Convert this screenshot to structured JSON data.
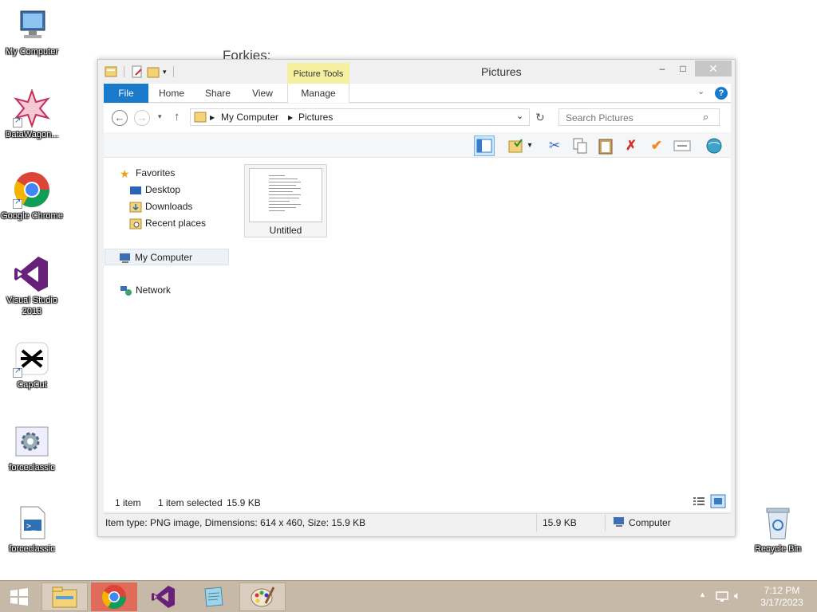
{
  "desktop": {
    "background_text": "Forkies:",
    "icons": [
      {
        "label": "My Computer"
      },
      {
        "label": "DataWagon..."
      },
      {
        "label": "Google Chrome"
      },
      {
        "label": "Visual Studio 2013"
      },
      {
        "label": "CapCut"
      },
      {
        "label": "forceclassic"
      },
      {
        "label": "forceclassic"
      },
      {
        "label": "Recycle Bin"
      }
    ]
  },
  "window": {
    "title": "Pictures",
    "context_tab": "Picture Tools",
    "ribbon_tabs": [
      "File",
      "Home",
      "Share",
      "View",
      "Manage"
    ],
    "address": {
      "segments": [
        "My Computer",
        "Pictures"
      ]
    },
    "search": {
      "placeholder": "Search Pictures"
    },
    "nav": {
      "favorites": "Favorites",
      "favorites_items": [
        "Desktop",
        "Downloads",
        "Recent places"
      ],
      "computer": "My Computer",
      "network": "Network"
    },
    "files": [
      {
        "name": "Untitled"
      }
    ],
    "status": {
      "item_count": "1 item",
      "selected": "1 item selected",
      "selected_size": "15.9 KB"
    },
    "details_bar": {
      "info": "Item type: PNG image, Dimensions: 614 x 460, Size: 15.9 KB",
      "size": "15.9 KB",
      "location": "Computer"
    }
  },
  "taskbar": {
    "time": "7:12 PM",
    "date": "3/17/2023"
  },
  "colors": {
    "accent": "#1979ca",
    "taskbar": "#c7b9a8",
    "context_tab": "#f5f0a0"
  }
}
